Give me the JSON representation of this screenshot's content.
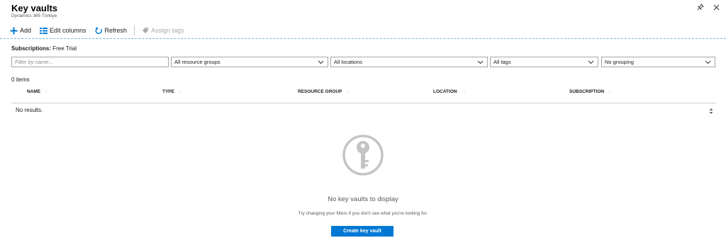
{
  "header": {
    "title": "Key vaults",
    "subtitle": "Dynamics 365 Türkiye"
  },
  "window_icons": [
    "pin-icon",
    "close-icon"
  ],
  "toolbar": {
    "add_label": "Add",
    "edit_columns_label": "Edit columns",
    "refresh_label": "Refresh",
    "assign_tags_label": "Assign tags"
  },
  "subscriptions": {
    "label": "Subscriptions:",
    "value": "Free Trial"
  },
  "filters": {
    "name_placeholder": "Filter by name...",
    "resource_groups": "All resource groups",
    "locations": "All locations",
    "tags": "All tags",
    "grouping": "No grouping"
  },
  "items_count": "0 items",
  "columns": [
    "NAME",
    "TYPE",
    "RESOURCE GROUP",
    "LOCATION",
    "SUBSCRIPTION"
  ],
  "no_results": "No results.",
  "empty_state": {
    "title": "No key vaults to display",
    "hint": "Try changing your filters if you don't see what you're looking for.",
    "button": "Create key vault"
  },
  "colors": {
    "accent": "#0078d4",
    "dashed_line": "#6fb7d8"
  }
}
